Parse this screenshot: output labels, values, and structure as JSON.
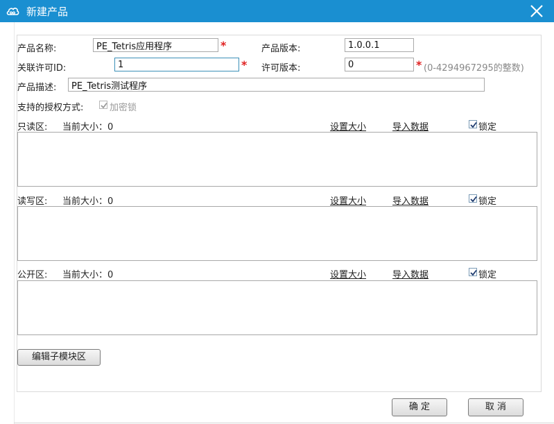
{
  "window": {
    "title": "新建产品",
    "accent": "#1a8fd1"
  },
  "form": {
    "product_name_label": "产品名称:",
    "product_name_value": "PE_Tetris应用程序",
    "product_version_label": "产品版本:",
    "product_version_value": "1.0.0.1",
    "license_id_label": "关联许可ID:",
    "license_id_value": "1",
    "license_version_label": "许可版本:",
    "license_version_value": "0",
    "license_version_hint": "(0-4294967295的整数)",
    "description_label": "产品描述:",
    "description_value": "PE_Tetris测试程序",
    "auth_label": "支持的授权方式:",
    "auth_option": "加密锁",
    "required_mark": "*"
  },
  "zones": [
    {
      "name": "只读区:",
      "size_text": "当前大小：0",
      "set_size": "设置大小",
      "import": "导入数据",
      "lock": "锁定"
    },
    {
      "name": "读写区:",
      "size_text": "当前大小：0",
      "set_size": "设置大小",
      "import": "导入数据",
      "lock": "锁定"
    },
    {
      "name": "公开区:",
      "size_text": "当前大小：0",
      "set_size": "设置大小",
      "import": "导入数据",
      "lock": "锁定"
    }
  ],
  "buttons": {
    "edit_submodule": "编辑子模块区",
    "ok": "确 定",
    "cancel": "取 消"
  },
  "icons": {
    "logo": "cloud-logo-icon",
    "close": "close-icon",
    "check": "checkmark-icon"
  }
}
